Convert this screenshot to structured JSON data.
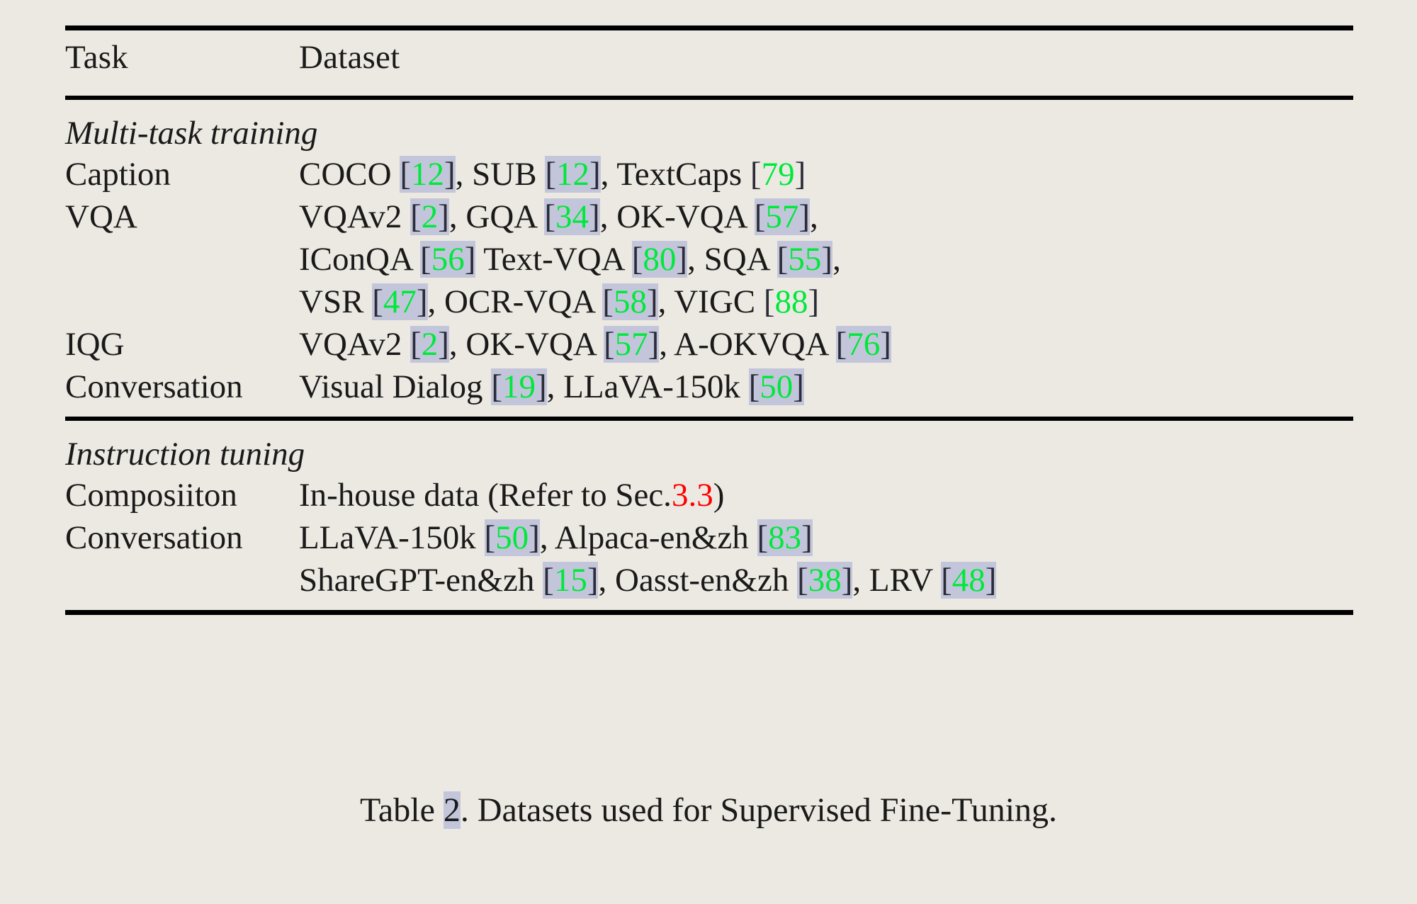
{
  "colors": {
    "page_background": "#ece9e2",
    "text": "#1a1a1a",
    "citation_green": "#00e83c",
    "citation_highlight": "#c3c6da",
    "section_reference_red": "#ff0000",
    "rule": "#000000"
  },
  "table": {
    "headers": {
      "task": "Task",
      "dataset": "Dataset"
    },
    "sections": [
      {
        "title": "Multi-task training",
        "rows": [
          {
            "task": "Caption",
            "lines": [
              [
                {
                  "t": "text",
                  "v": "COCO "
                },
                {
                  "t": "cit",
                  "v": "12",
                  "hl": true
                },
                {
                  "t": "text",
                  "v": ", SUB "
                },
                {
                  "t": "cit",
                  "v": "12",
                  "hl": true
                },
                {
                  "t": "text",
                  "v": ", TextCaps "
                },
                {
                  "t": "cit",
                  "v": "79",
                  "hl": false
                }
              ]
            ]
          },
          {
            "task": "VQA",
            "lines": [
              [
                {
                  "t": "text",
                  "v": "VQAv2 "
                },
                {
                  "t": "cit",
                  "v": "2",
                  "hl": true
                },
                {
                  "t": "text",
                  "v": ", GQA "
                },
                {
                  "t": "cit",
                  "v": "34",
                  "hl": true
                },
                {
                  "t": "text",
                  "v": ", OK-VQA "
                },
                {
                  "t": "cit",
                  "v": "57",
                  "hl": true
                },
                {
                  "t": "text",
                  "v": ","
                }
              ],
              [
                {
                  "t": "text",
                  "v": "IConQA "
                },
                {
                  "t": "cit",
                  "v": "56",
                  "hl": true
                },
                {
                  "t": "text",
                  "v": " Text-VQA "
                },
                {
                  "t": "cit",
                  "v": "80",
                  "hl": true
                },
                {
                  "t": "text",
                  "v": ", SQA "
                },
                {
                  "t": "cit",
                  "v": "55",
                  "hl": true
                },
                {
                  "t": "text",
                  "v": ","
                }
              ],
              [
                {
                  "t": "text",
                  "v": "VSR "
                },
                {
                  "t": "cit",
                  "v": "47",
                  "hl": true
                },
                {
                  "t": "text",
                  "v": ", OCR-VQA "
                },
                {
                  "t": "cit",
                  "v": "58",
                  "hl": true
                },
                {
                  "t": "text",
                  "v": ", VIGC "
                },
                {
                  "t": "cit",
                  "v": "88",
                  "hl": false
                }
              ]
            ]
          },
          {
            "task": "IQG",
            "lines": [
              [
                {
                  "t": "text",
                  "v": "VQAv2 "
                },
                {
                  "t": "cit",
                  "v": "2",
                  "hl": true
                },
                {
                  "t": "text",
                  "v": ", OK-VQA "
                },
                {
                  "t": "cit",
                  "v": "57",
                  "hl": true
                },
                {
                  "t": "text",
                  "v": ", A-OKVQA "
                },
                {
                  "t": "cit",
                  "v": "76",
                  "hl": true
                }
              ]
            ]
          },
          {
            "task": "Conversation",
            "lines": [
              [
                {
                  "t": "text",
                  "v": "Visual Dialog "
                },
                {
                  "t": "cit",
                  "v": "19",
                  "hl": true
                },
                {
                  "t": "text",
                  "v": ", LLaVA-150k "
                },
                {
                  "t": "cit",
                  "v": "50",
                  "hl": true
                }
              ]
            ]
          }
        ]
      },
      {
        "title": "Instruction tuning",
        "rows": [
          {
            "task": "Composiiton",
            "lines": [
              [
                {
                  "t": "text",
                  "v": "In-house data (Refer to Sec."
                },
                {
                  "t": "secref",
                  "v": "3.3"
                },
                {
                  "t": "text",
                  "v": ")"
                }
              ]
            ]
          },
          {
            "task": "Conversation",
            "lines": [
              [
                {
                  "t": "text",
                  "v": "LLaVA-150k "
                },
                {
                  "t": "cit",
                  "v": "50",
                  "hl": true
                },
                {
                  "t": "text",
                  "v": ", Alpaca-en&zh "
                },
                {
                  "t": "cit",
                  "v": "83",
                  "hl": true
                }
              ],
              [
                {
                  "t": "text",
                  "v": "ShareGPT-en&zh  "
                },
                {
                  "t": "cit",
                  "v": "15",
                  "hl": true
                },
                {
                  "t": "text",
                  "v": ", Oasst-en&zh  "
                },
                {
                  "t": "cit",
                  "v": "38",
                  "hl": true
                },
                {
                  "t": "text",
                  "v": ", LRV "
                },
                {
                  "t": "cit",
                  "v": "48",
                  "hl": true
                }
              ]
            ]
          }
        ]
      }
    ]
  },
  "caption": {
    "prefix": "Table ",
    "number": "2",
    "suffix": ". Datasets used for Supervised Fine-Tuning."
  }
}
